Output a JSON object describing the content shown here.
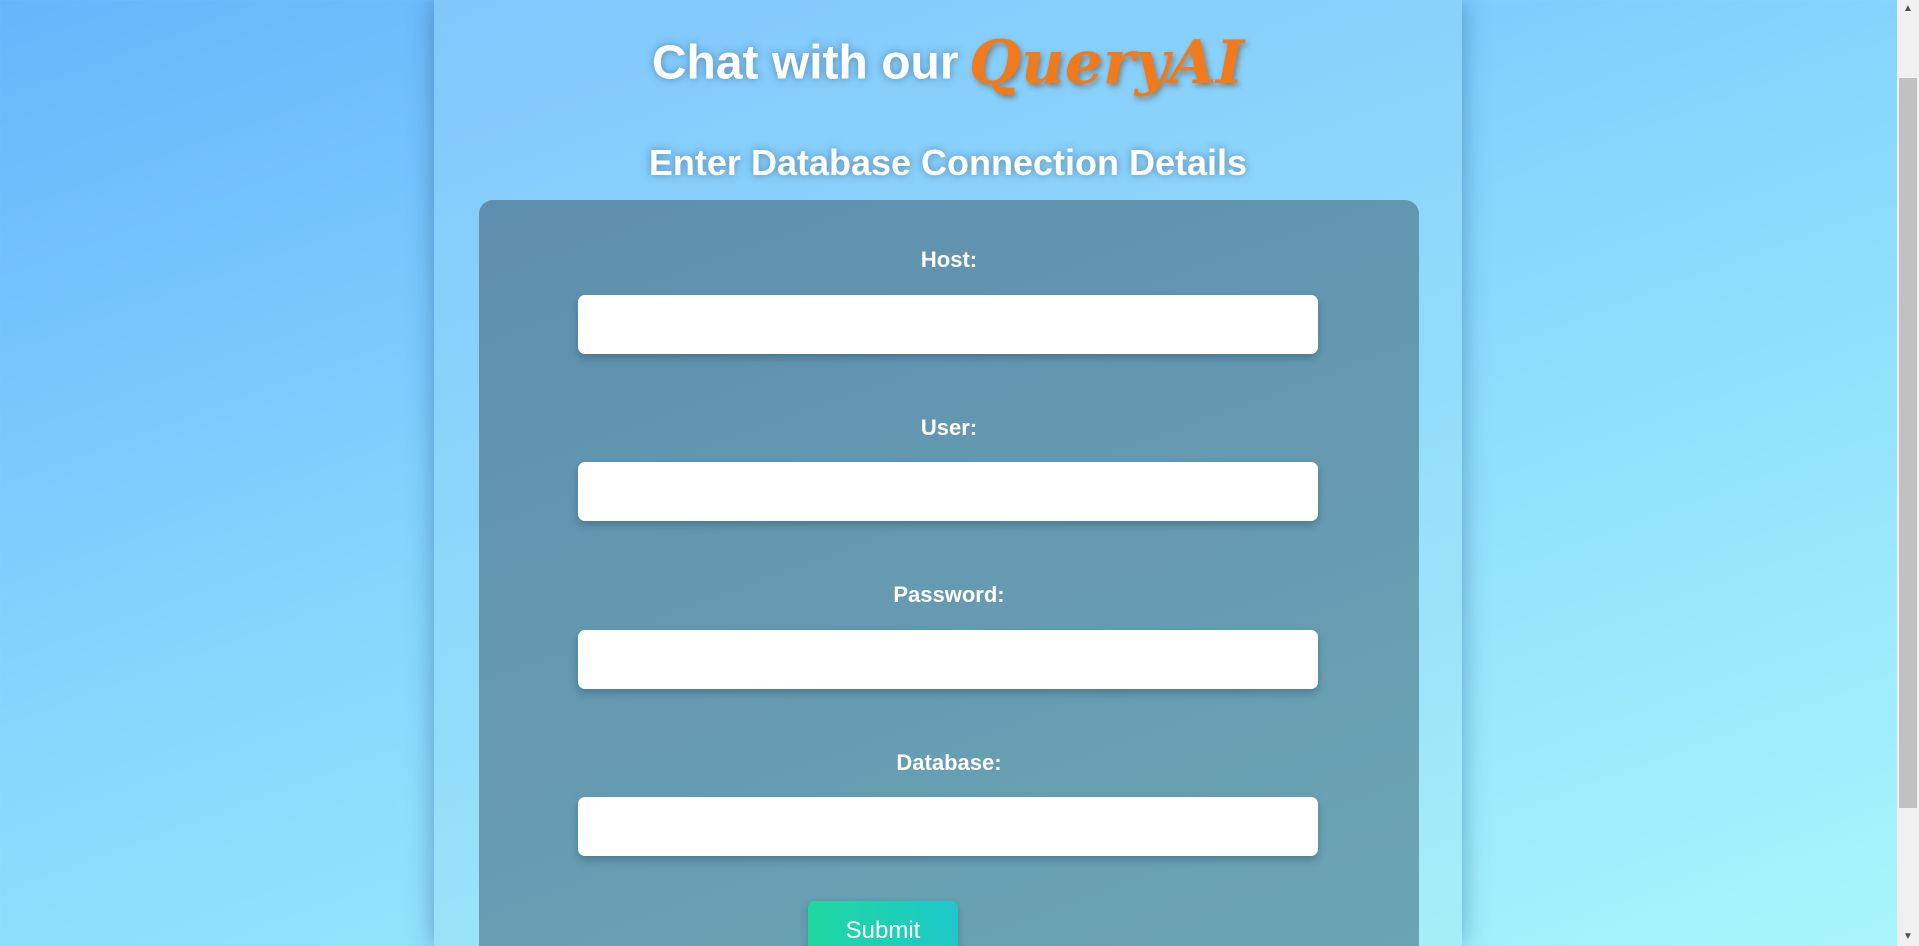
{
  "header": {
    "title_prefix": "Chat with our",
    "brand_name": "QueryAI",
    "subtitle": "Enter Database Connection Details"
  },
  "form": {
    "fields": [
      {
        "label": "Host:",
        "value": "",
        "placeholder": ""
      },
      {
        "label": "User:",
        "value": "",
        "placeholder": ""
      },
      {
        "label": "Password:",
        "value": "",
        "placeholder": ""
      },
      {
        "label": "Database:",
        "value": "",
        "placeholder": ""
      }
    ],
    "submit_label": "Submit"
  },
  "scrollbar": {
    "up_icon": "up-arrow-icon",
    "down_icon": "down-arrow-icon"
  },
  "colors": {
    "brand": "#f07a1c",
    "card": "#6699b0",
    "submit": "#1fd0b0"
  }
}
